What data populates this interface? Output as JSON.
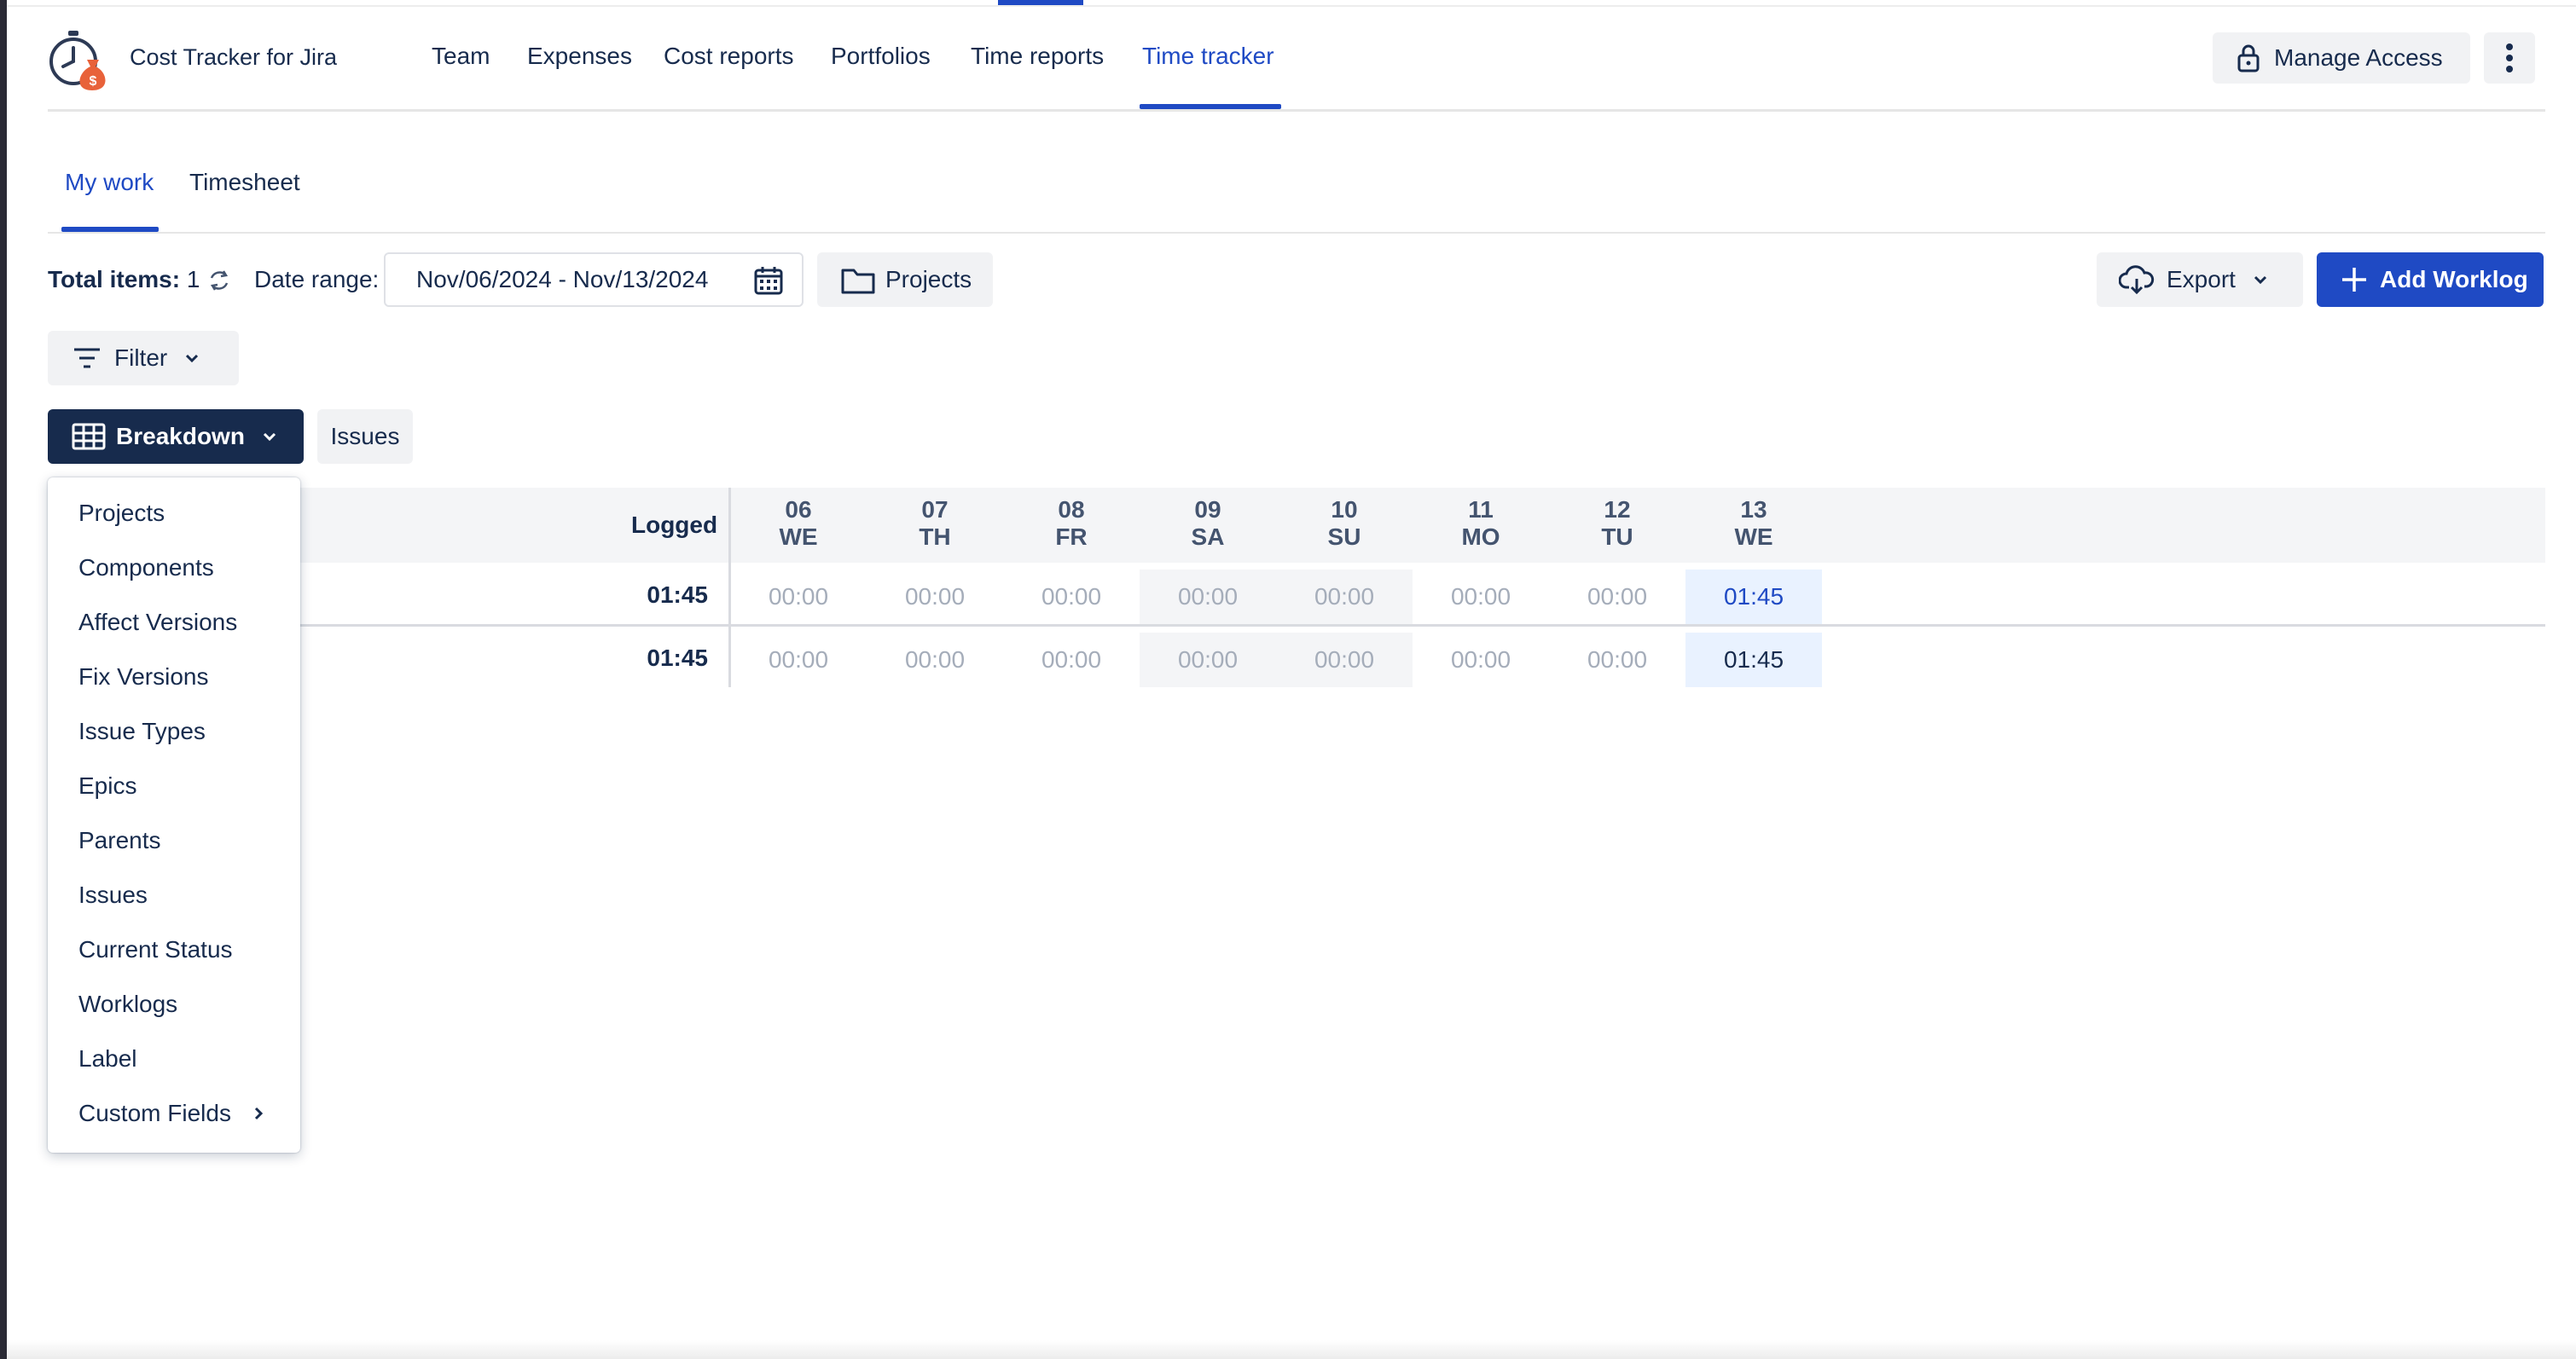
{
  "app": {
    "title": "Cost Tracker for Jira"
  },
  "nav": {
    "items": [
      "Team",
      "Expenses",
      "Cost reports",
      "Portfolios",
      "Time reports",
      "Time tracker"
    ],
    "active": "Time tracker"
  },
  "header": {
    "manage_access": "Manage Access"
  },
  "subtabs": {
    "items": [
      "My work",
      "Timesheet"
    ],
    "active": "My work"
  },
  "toolbar": {
    "total_label": "Total items:",
    "total_value": "1",
    "date_label": "Date range:",
    "date_value": "Nov/06/2024 - Nov/13/2024",
    "projects_label": "Projects",
    "export_label": "Export",
    "add_worklog_label": "Add Worklog",
    "filter_label": "Filter"
  },
  "breakdown": {
    "label": "Breakdown",
    "selected_tag": "Issues"
  },
  "table": {
    "logged_header": "Logged",
    "days": [
      {
        "num": "06",
        "dow": "WE"
      },
      {
        "num": "07",
        "dow": "TH"
      },
      {
        "num": "08",
        "dow": "FR"
      },
      {
        "num": "09",
        "dow": "SA"
      },
      {
        "num": "10",
        "dow": "SU"
      },
      {
        "num": "11",
        "dow": "MO"
      },
      {
        "num": "12",
        "dow": "TU"
      },
      {
        "num": "13",
        "dow": "WE"
      }
    ],
    "row": {
      "logged": "01:45",
      "values": [
        "00:00",
        "00:00",
        "00:00",
        "00:00",
        "00:00",
        "00:00",
        "00:00",
        "01:45"
      ]
    },
    "total": {
      "logged": "01:45",
      "values": [
        "00:00",
        "00:00",
        "00:00",
        "00:00",
        "00:00",
        "00:00",
        "00:00",
        "01:45"
      ]
    }
  },
  "menu": {
    "items": [
      "Projects",
      "Components",
      "Affect Versions",
      "Fix Versions",
      "Issue Types",
      "Epics",
      "Parents",
      "Issues",
      "Current Status",
      "Worklogs",
      "Label",
      "Custom Fields"
    ]
  },
  "colors": {
    "accent": "#1f4ac4",
    "dark": "#172b4d",
    "logo_orange": "#e8623a"
  }
}
